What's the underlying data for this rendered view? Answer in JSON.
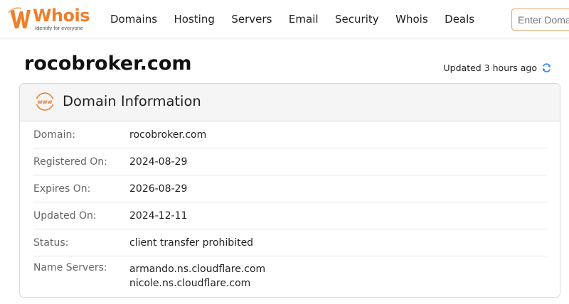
{
  "brand": {
    "name": "Whois",
    "tagline": "Identify for everyone",
    "accent_color": "#f07f2a"
  },
  "nav": {
    "items": [
      "Domains",
      "Hosting",
      "Servers",
      "Email",
      "Security",
      "Whois",
      "Deals"
    ]
  },
  "search": {
    "placeholder": "Enter Domain"
  },
  "page": {
    "domain": "rocobroker.com",
    "updated_text": "Updated 3 hours ago",
    "refresh_icon": "refresh-icon"
  },
  "card": {
    "icon": "www-icon",
    "icon_text": "www",
    "title": "Domain Information",
    "rows": [
      {
        "label": "Domain:",
        "value": "rocobroker.com"
      },
      {
        "label": "Registered On:",
        "value": "2024-08-29"
      },
      {
        "label": "Expires On:",
        "value": "2026-08-29"
      },
      {
        "label": "Updated On:",
        "value": "2024-12-11"
      },
      {
        "label": "Status:",
        "value": "client transfer prohibited"
      }
    ],
    "name_servers": {
      "label": "Name Servers:",
      "values": [
        "armando.ns.cloudflare.com",
        "nicole.ns.cloudflare.com"
      ]
    }
  }
}
